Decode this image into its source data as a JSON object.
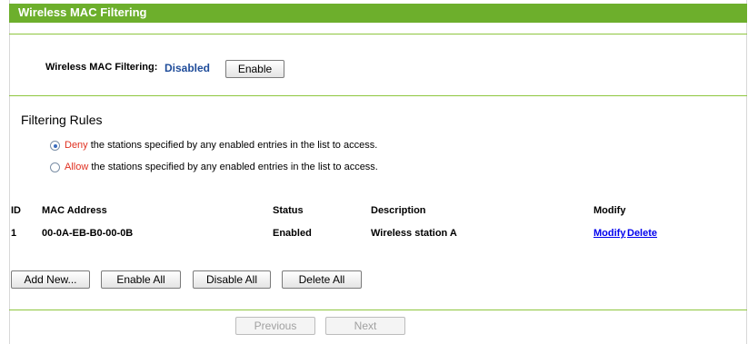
{
  "title": "Wireless MAC Filtering",
  "filtering": {
    "label": "Wireless MAC Filtering:",
    "status": "Disabled",
    "enable_button": "Enable"
  },
  "rules": {
    "heading": "Filtering Rules",
    "deny": {
      "keyword": "Deny",
      "text": " the stations specified by any enabled entries in the list to access.",
      "checked": true
    },
    "allow": {
      "keyword": "Allow",
      "text": " the stations specified by any enabled entries in the list to access.",
      "checked": false
    }
  },
  "table": {
    "headers": {
      "id": "ID",
      "mac": "MAC Address",
      "status": "Status",
      "description": "Description",
      "modify": "Modify"
    },
    "rows": [
      {
        "id": "1",
        "mac": "00-0A-EB-B0-00-0B",
        "status": "Enabled",
        "description": "Wireless station A",
        "modify": "Modify",
        "delete": "Delete"
      }
    ]
  },
  "actions": {
    "add_new": "Add New...",
    "enable_all": "Enable All",
    "disable_all": "Disable All",
    "delete_all": "Delete All"
  },
  "pager": {
    "previous": "Previous",
    "next": "Next"
  },
  "colors": {
    "header_green": "#6daf2c",
    "line_green": "#8ec63f",
    "status_blue": "#1f4c9a",
    "keyword_red": "#e03020"
  }
}
